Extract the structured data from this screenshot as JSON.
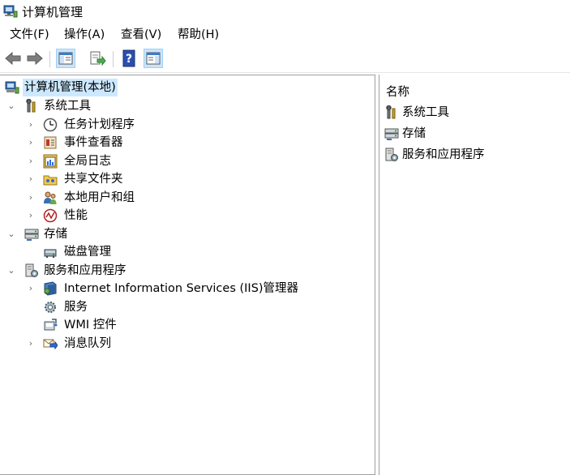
{
  "window": {
    "title": "计算机管理"
  },
  "menu": [
    "文件(F)",
    "操作(A)",
    "查看(V)",
    "帮助(H)"
  ],
  "toolbar": {
    "buttons": [
      "back-icon",
      "forward-icon",
      "show-hide-tree-icon",
      "export-list-icon",
      "help-icon",
      "show-hide-action-pane-icon"
    ]
  },
  "tree": {
    "root": "计算机管理(本地)",
    "system_tools": "系统工具",
    "task_scheduler": "任务计划程序",
    "event_viewer": "事件查看器",
    "global_log": "全局日志",
    "shared_folders": "共享文件夹",
    "local_users": "本地用户和组",
    "performance": "性能",
    "storage": "存储",
    "disk_management": "磁盘管理",
    "services_apps": "服务和应用程序",
    "iis": "Internet Information Services (IIS)管理器",
    "services": "服务",
    "wmi": "WMI 控件",
    "message_queue": "消息队列"
  },
  "list": {
    "header": "名称",
    "items": [
      "系统工具",
      "存储",
      "服务和应用程序"
    ]
  },
  "colors": {
    "selection": "#cce8ff",
    "toolbar_active": "#cce4f7"
  }
}
